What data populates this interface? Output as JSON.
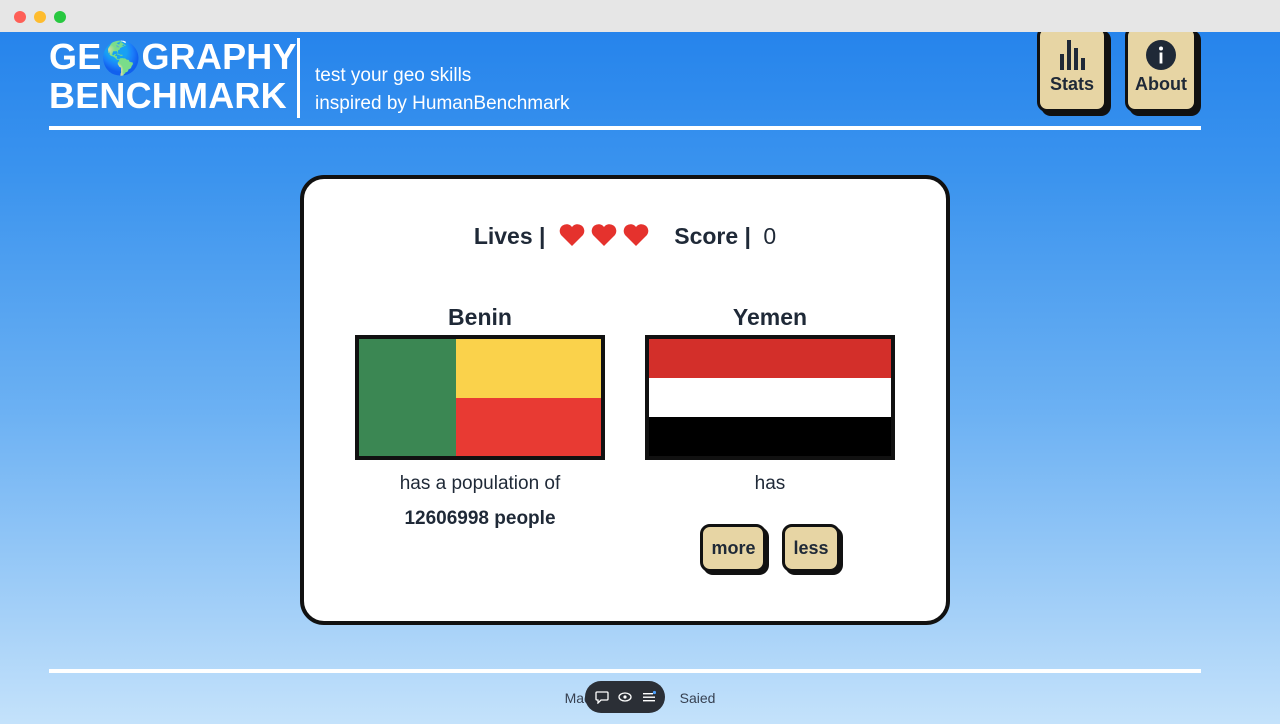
{
  "window": {
    "controls": [
      "close",
      "minimize",
      "zoom"
    ]
  },
  "header": {
    "logo_line1_a": "GE",
    "logo_globe": "🌎",
    "logo_line1_b": "GRAPHY",
    "logo_line2": "BENCHMARK",
    "tagline1": "test your geo skills",
    "tagline2": "inspired by HumanBenchmark",
    "stats_label": "Stats",
    "about_label": "About"
  },
  "game": {
    "lives_label": "Lives |",
    "lives_count": 3,
    "score_label": "Score |",
    "score_value": "0",
    "left": {
      "name": "Benin",
      "flag_icon": "benin-flag",
      "text": "has a population of",
      "value": "12606998 people"
    },
    "right": {
      "name": "Yemen",
      "flag_icon": "yemen-flag",
      "text": "has",
      "more_label": "more",
      "less_label": "less"
    }
  },
  "footer": {
    "text_left": "Made",
    "text_right": "Saied"
  },
  "colors": {
    "accent_button": "#e7d5a4",
    "heart": "#e5322d",
    "benin_green": "#3b8753",
    "benin_yellow": "#fad24b",
    "benin_red": "#e83a33",
    "yemen_red": "#d32f2a"
  }
}
